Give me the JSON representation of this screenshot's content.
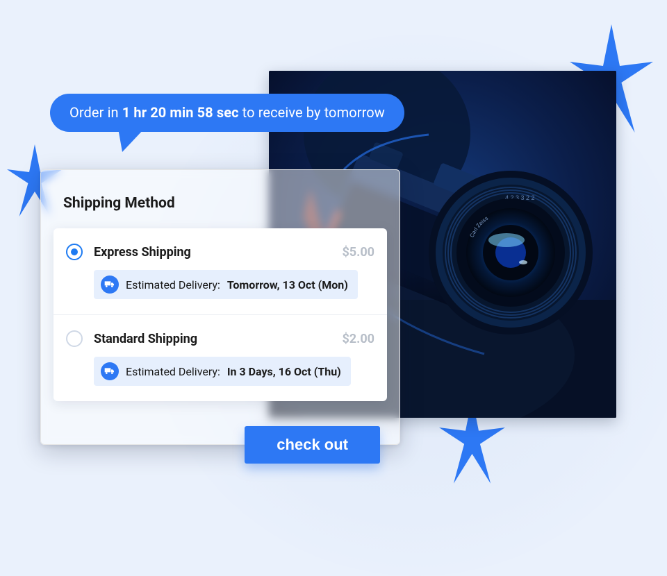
{
  "countdown": {
    "prefix": "Order in ",
    "time": "1 hr 20 min 58 sec",
    "suffix": " to receive by tomorrow"
  },
  "card": {
    "title": "Shipping Method",
    "options": [
      {
        "name": "Express Shipping",
        "price": "$5.00",
        "estimate_prefix": "Estimated Delivery: ",
        "estimate_date": "Tomorrow, 13 Oct (Mon)",
        "selected": true
      },
      {
        "name": "Standard Shipping",
        "price": "$2.00",
        "estimate_prefix": "Estimated Delivery: ",
        "estimate_date": "In 3 Days, 16 Oct (Thu)",
        "selected": false
      }
    ]
  },
  "checkout_label": "check out"
}
